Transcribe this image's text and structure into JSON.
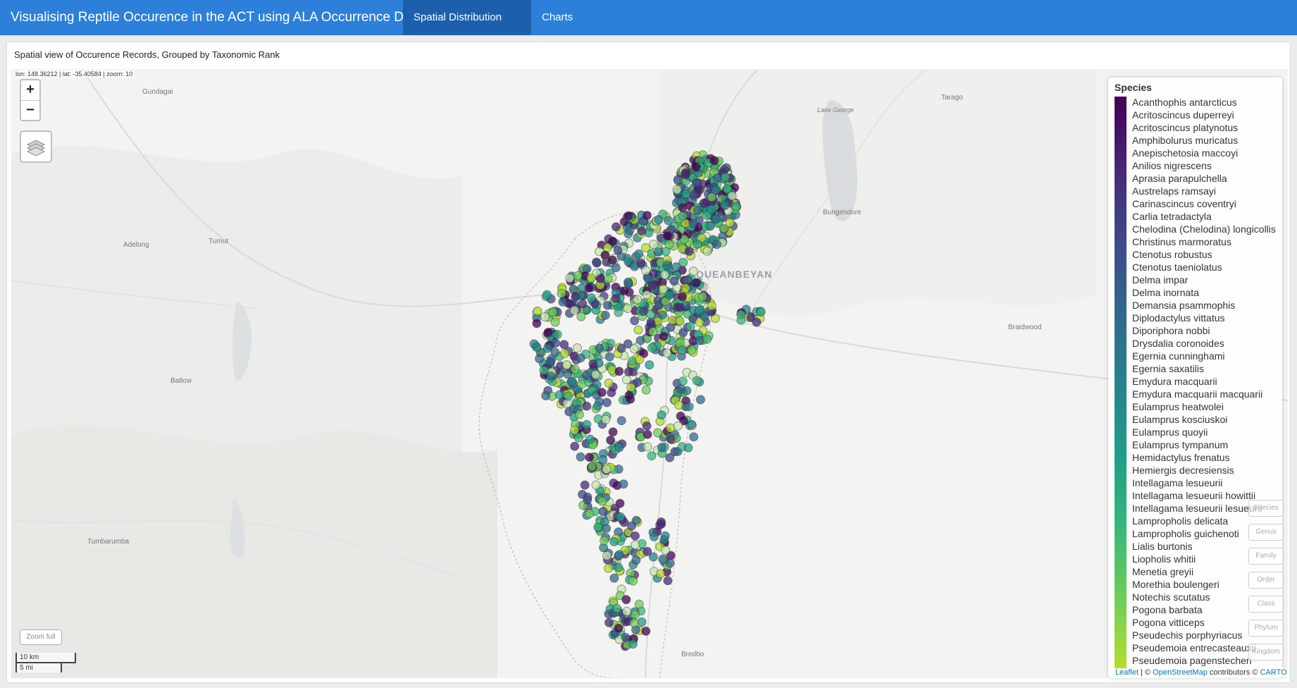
{
  "app": {
    "title": "Visualising Reptile Occurence in the ACT using ALA Occurrence Data"
  },
  "tabs": [
    {
      "label": "Spatial Distribution Map"
    },
    {
      "label": "Charts"
    }
  ],
  "panel": {
    "title": "Spatial view of Occurence Records, Grouped by Taxonomic Rank"
  },
  "map": {
    "coords": "lon: 148.36212 | lat: -35.40584 | zoom: 10",
    "zoom_in": "+",
    "zoom_out": "−",
    "zoom_full": "Zoom full",
    "scale_km": "10 km",
    "scale_mi": "5 mi",
    "places": [
      "Gundagai",
      "Tarago",
      "Lake George",
      "Bungendore",
      "Adelong",
      "Tumut",
      "QUEANBEYAN",
      "Braidwood",
      "Batlow",
      "Tumbarumba",
      "Bredbo"
    ]
  },
  "legend": {
    "title": "Species",
    "palette": "viridis",
    "items": [
      "Acanthophis antarcticus",
      "Acritoscincus duperreyi",
      "Acritoscincus platynotus",
      "Amphibolurus muricatus",
      "Anepischetosia maccoyi",
      "Anilios nigrescens",
      "Aprasia parapulchella",
      "Austrelaps ramsayi",
      "Carinascincus coventryi",
      "Carlia tetradactyla",
      "Chelodina (Chelodina) longicollis",
      "Christinus marmoratus",
      "Ctenotus robustus",
      "Ctenotus taeniolatus",
      "Delma impar",
      "Delma inornata",
      "Demansia psammophis",
      "Diplodactylus vittatus",
      "Diporiphora nobbi",
      "Drysdalia coronoides",
      "Egernia cunninghami",
      "Egernia saxatilis",
      "Emydura macquarii",
      "Emydura macquarii macquarii",
      "Eulamprus heatwolei",
      "Eulamprus kosciuskoi",
      "Eulamprus quoyii",
      "Eulamprus tympanum",
      "Hemidactylus frenatus",
      "Hemiergis decresiensis",
      "Intellagama lesueurii",
      "Intellagama lesueurii howittii",
      "Intellagama lesueurii lesueurii",
      "Lampropholis delicata",
      "Lampropholis guichenoti",
      "Lialis burtonis",
      "Liopholis whitii",
      "Menetia greyii",
      "Morethia boulengeri",
      "Notechis scutatus",
      "Pogona barbata",
      "Pogona vitticeps",
      "Pseudechis porphyriacus",
      "Pseudemoia entrecasteauxii",
      "Pseudemoia pagenstecheri"
    ]
  },
  "rank_buttons": [
    "Species",
    "Genus",
    "Family",
    "Order",
    "Class",
    "Phylum",
    "Kingdom"
  ],
  "attribution": {
    "leaflet": "Leaflet",
    "sep": " | © ",
    "osm": "OpenStreetMap",
    "contrib": " contributors © ",
    "carto": "CARTO"
  }
}
